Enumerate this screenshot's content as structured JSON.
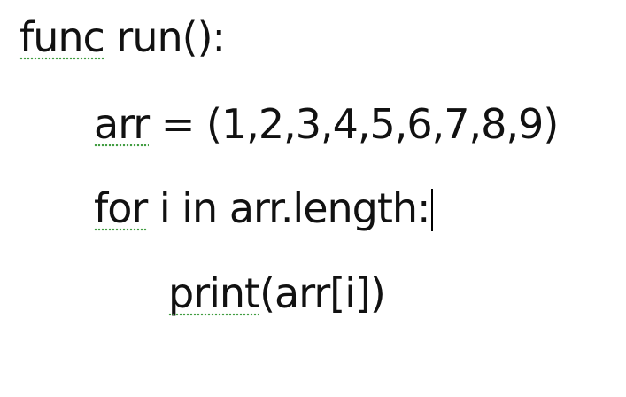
{
  "code": {
    "line1": {
      "word": "func",
      "rest": " run():"
    },
    "line2": {
      "word": "arr",
      "rest": " = (1,2,3,4,5,6,7,8,9)"
    },
    "line3": {
      "word": "for",
      "rest": " i in arr.length:"
    },
    "line4": {
      "word": "print",
      "rest": "(arr[i])"
    }
  },
  "colors": {
    "text": "#111111",
    "spellcheck_underline": "#3c9a3c",
    "background": "#ffffff"
  }
}
